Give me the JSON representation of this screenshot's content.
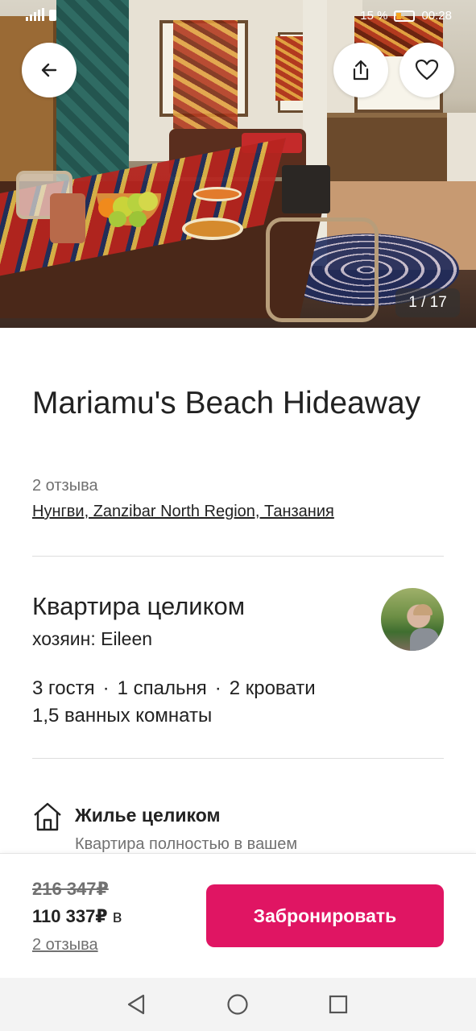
{
  "status_bar": {
    "battery": "15 %",
    "time": "00:28"
  },
  "hero": {
    "photo_counter": "1 / 17",
    "icons": [
      "arrow-left-icon",
      "share-icon",
      "heart-icon"
    ]
  },
  "listing": {
    "title": "Mariamu's Beach Hideaway",
    "reviews": "2 отзыва",
    "location": "Нунгви, Zanzibar North Region, Танзания",
    "type": "Квартира целиком",
    "host": "хозяин: Eileen",
    "specs": [
      "3 гостя",
      "1 спальня",
      "2 кровати"
    ],
    "baths": "1,5 ванных комнаты",
    "spec_separator": "·"
  },
  "feature": {
    "title": "Жилье целиком",
    "description": "Квартира полностью в вашем"
  },
  "booking": {
    "old_price": "216 347₽",
    "new_price": "110 337₽",
    "price_suffix": "в",
    "reviews_link": "2 отзыва",
    "book_label": "Забронировать",
    "accent": "#e01563"
  }
}
